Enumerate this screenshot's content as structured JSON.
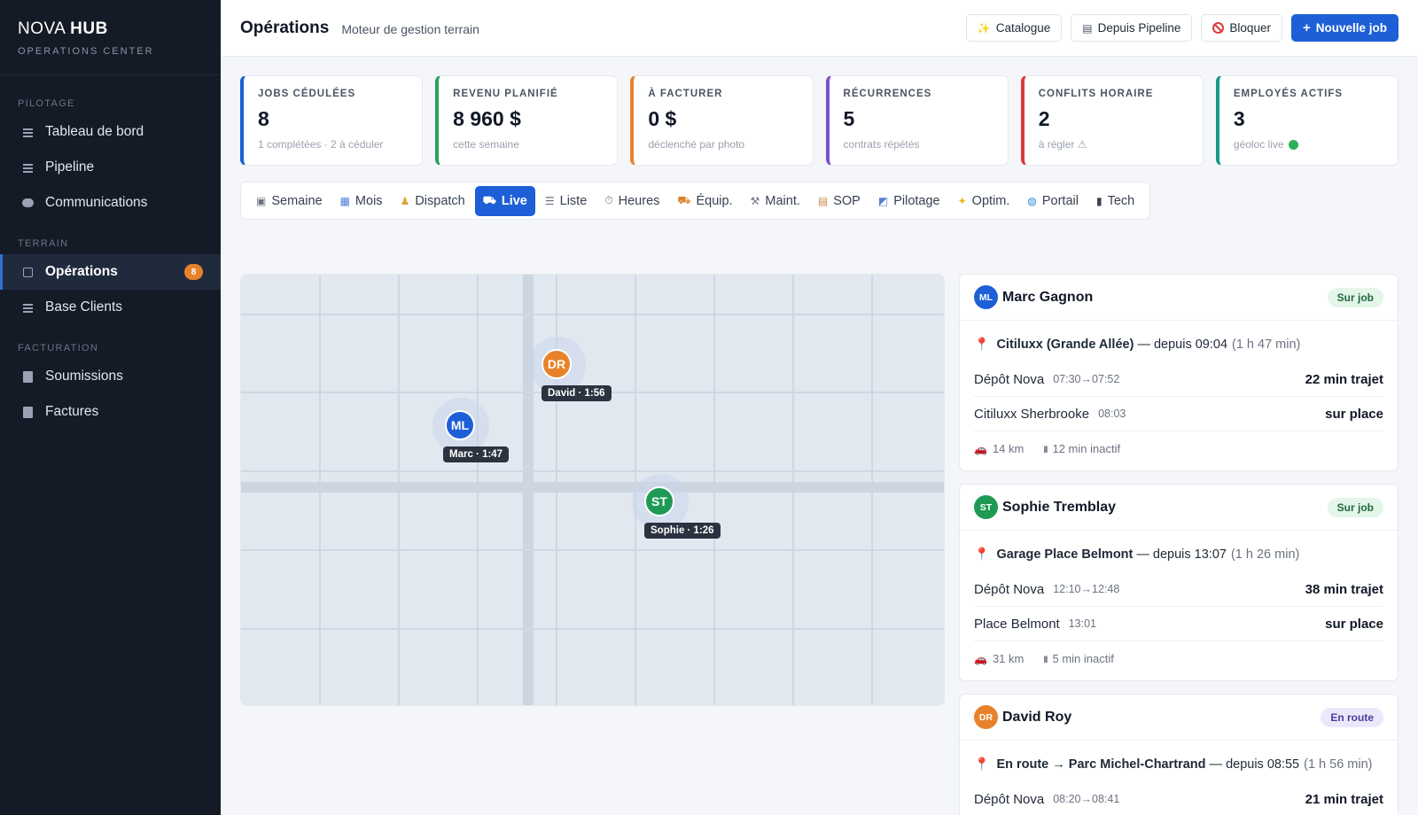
{
  "brand": {
    "name_light": "NOVA",
    "name_bold": "HUB",
    "subtitle": "OPERATIONS CENTER"
  },
  "sidebar": {
    "sections": [
      {
        "label": "PILOTAGE",
        "items": [
          {
            "label": "Tableau de bord",
            "icon": "dashboard-icon"
          },
          {
            "label": "Pipeline",
            "icon": "pipeline-icon"
          },
          {
            "label": "Communications",
            "icon": "chat-bubble-icon"
          }
        ]
      },
      {
        "label": "TERRAIN",
        "items": [
          {
            "label": "Opérations",
            "icon": "operations-icon",
            "badge": "8",
            "active": true
          },
          {
            "label": "Base Clients",
            "icon": "clients-icon"
          }
        ]
      },
      {
        "label": "FACTURATION",
        "items": [
          {
            "label": "Soumissions",
            "icon": "document-icon"
          },
          {
            "label": "Factures",
            "icon": "invoice-icon"
          }
        ]
      }
    ]
  },
  "header": {
    "title": "Opérations",
    "subtitle": "Moteur de gestion terrain",
    "actions": [
      {
        "label": "Catalogue",
        "icon": "✨"
      },
      {
        "label": "Depuis Pipeline",
        "icon": "▤"
      },
      {
        "label": "Bloquer",
        "icon": "⃠"
      },
      {
        "label": "Nouvelle job",
        "icon": "+"
      }
    ]
  },
  "kpis": [
    {
      "label": "JOBS CÉDULÉES",
      "value": "8",
      "note": "1 complétées · 2 à céduler",
      "color": "#1d5fd6"
    },
    {
      "label": "REVENU PLANIFIÉ",
      "value": "8 960 $",
      "note": "cette semaine",
      "color": "#27a25a"
    },
    {
      "label": "À FACTURER",
      "value": "0 $",
      "note": "déclenché par photo",
      "color": "#e8822a"
    },
    {
      "label": "RÉCURRENCES",
      "value": "5",
      "note": "contrats répétés",
      "color": "#7b4fd1"
    },
    {
      "label": "CONFLITS HORAIRE",
      "value": "2",
      "note": "à régler ⚠",
      "color": "#dc3b3b"
    },
    {
      "label": "EMPLOYÉS ACTIFS",
      "value": "3",
      "note": "géoloc live",
      "color": "#17998a"
    }
  ],
  "tabs": [
    {
      "label": "Semaine",
      "icon": "▣"
    },
    {
      "label": "Mois",
      "icon": "▦"
    },
    {
      "label": "Dispatch",
      "icon": "♟"
    },
    {
      "label": "Live",
      "icon": "⛟",
      "active": true
    },
    {
      "label": "Liste",
      "icon": "☰"
    },
    {
      "label": "Heures",
      "icon": "⏱"
    },
    {
      "label": "Équip.",
      "icon": "⛟"
    },
    {
      "label": "Maint.",
      "icon": "⚒"
    },
    {
      "label": "SOP",
      "icon": "▤"
    },
    {
      "label": "Pilotage",
      "icon": "◩"
    },
    {
      "label": "Optim.",
      "icon": "✦"
    },
    {
      "label": "Portail",
      "icon": "◍"
    },
    {
      "label": "Tech",
      "icon": "▮"
    }
  ],
  "map": {
    "pins": [
      {
        "initials": "DR",
        "tag": "David · 1:56",
        "color": "#e8822a"
      },
      {
        "initials": "ML",
        "tag": "Marc · 1:47",
        "color": "#1d5fd6"
      },
      {
        "initials": "ST",
        "tag": "Sophie · 1:26",
        "color": "#1f9a56"
      }
    ]
  },
  "employees": [
    {
      "initials": "ML",
      "name": "Marc Gagnon",
      "status": "Sur job",
      "status_kind": "onjob",
      "color": "#1d5fd6",
      "location": "Citiluxx (Grande Allée)",
      "since": "— depuis 09:04",
      "duration": "(1 h 47 min)",
      "rows": [
        {
          "place": "Dépôt Nova",
          "time": "07:30→07:52",
          "right": "22 min trajet"
        },
        {
          "place": "Citiluxx Sherbrooke",
          "time": "08:03",
          "right": "sur place"
        }
      ],
      "distance": "14 km",
      "idle": "12 min inactif"
    },
    {
      "initials": "ST",
      "name": "Sophie Tremblay",
      "status": "Sur job",
      "status_kind": "onjob",
      "color": "#1f9a56",
      "location": "Garage Place Belmont",
      "since": "— depuis 13:07",
      "duration": "(1 h 26 min)",
      "rows": [
        {
          "place": "Dépôt Nova",
          "time": "12:10→12:48",
          "right": "38 min trajet"
        },
        {
          "place": "Place Belmont",
          "time": "13:01",
          "right": "sur place"
        }
      ],
      "distance": "31 km",
      "idle": "5 min inactif"
    },
    {
      "initials": "DR",
      "name": "David Roy",
      "status": "En route",
      "status_kind": "enroute",
      "color": "#e8822a",
      "location": "En route → Parc Michel-Chartrand",
      "since": "— depuis 08:55",
      "duration": "(1 h 56 min)",
      "rows": [
        {
          "place": "Dépôt Nova",
          "time": "08:20→08:41",
          "right": "21 min trajet"
        }
      ],
      "distance": "",
      "idle": ""
    }
  ]
}
